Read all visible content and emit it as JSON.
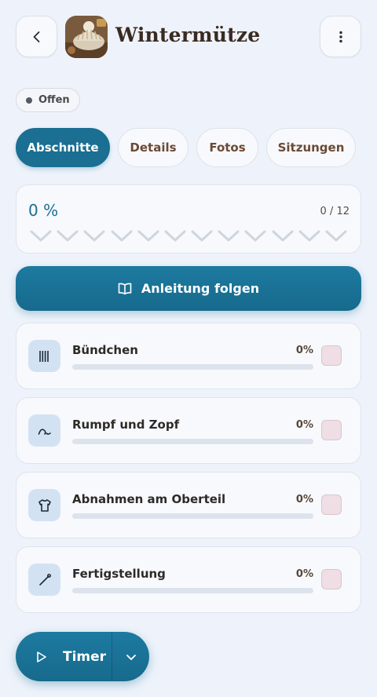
{
  "header": {
    "title": "Wintermütze",
    "back_icon": "chevron-left-icon",
    "menu_icon": "more-vertical-icon"
  },
  "status": {
    "label": "Offen",
    "color": "#545b66"
  },
  "tabs": [
    {
      "label": "Abschnitte",
      "active": true
    },
    {
      "label": "Details",
      "active": false
    },
    {
      "label": "Fotos",
      "active": false
    },
    {
      "label": "Sitzungen",
      "active": false
    }
  ],
  "progress": {
    "percent_label": "0 %",
    "count_label": "0 / 12",
    "completed": 0,
    "total": 12
  },
  "follow_button": {
    "label": "Anleitung folgen",
    "icon": "book-open-icon"
  },
  "sections": [
    {
      "name": "Bündchen",
      "percent_label": "0%",
      "progress": 0,
      "icon": "ribbing-icon"
    },
    {
      "name": "Rumpf und Zopf",
      "percent_label": "0%",
      "progress": 0,
      "icon": "cable-icon"
    },
    {
      "name": "Abnahmen am Oberteil",
      "percent_label": "0%",
      "progress": 0,
      "icon": "shirt-icon"
    },
    {
      "name": "Fertigstellung",
      "percent_label": "0%",
      "progress": 0,
      "icon": "needle-icon"
    }
  ],
  "timer": {
    "label": "Timer",
    "icon": "play-icon",
    "dropdown_icon": "chevron-down-icon"
  },
  "colors": {
    "accent": "#1a6f92",
    "background": "#eef3fb",
    "title": "#3a2b22"
  }
}
